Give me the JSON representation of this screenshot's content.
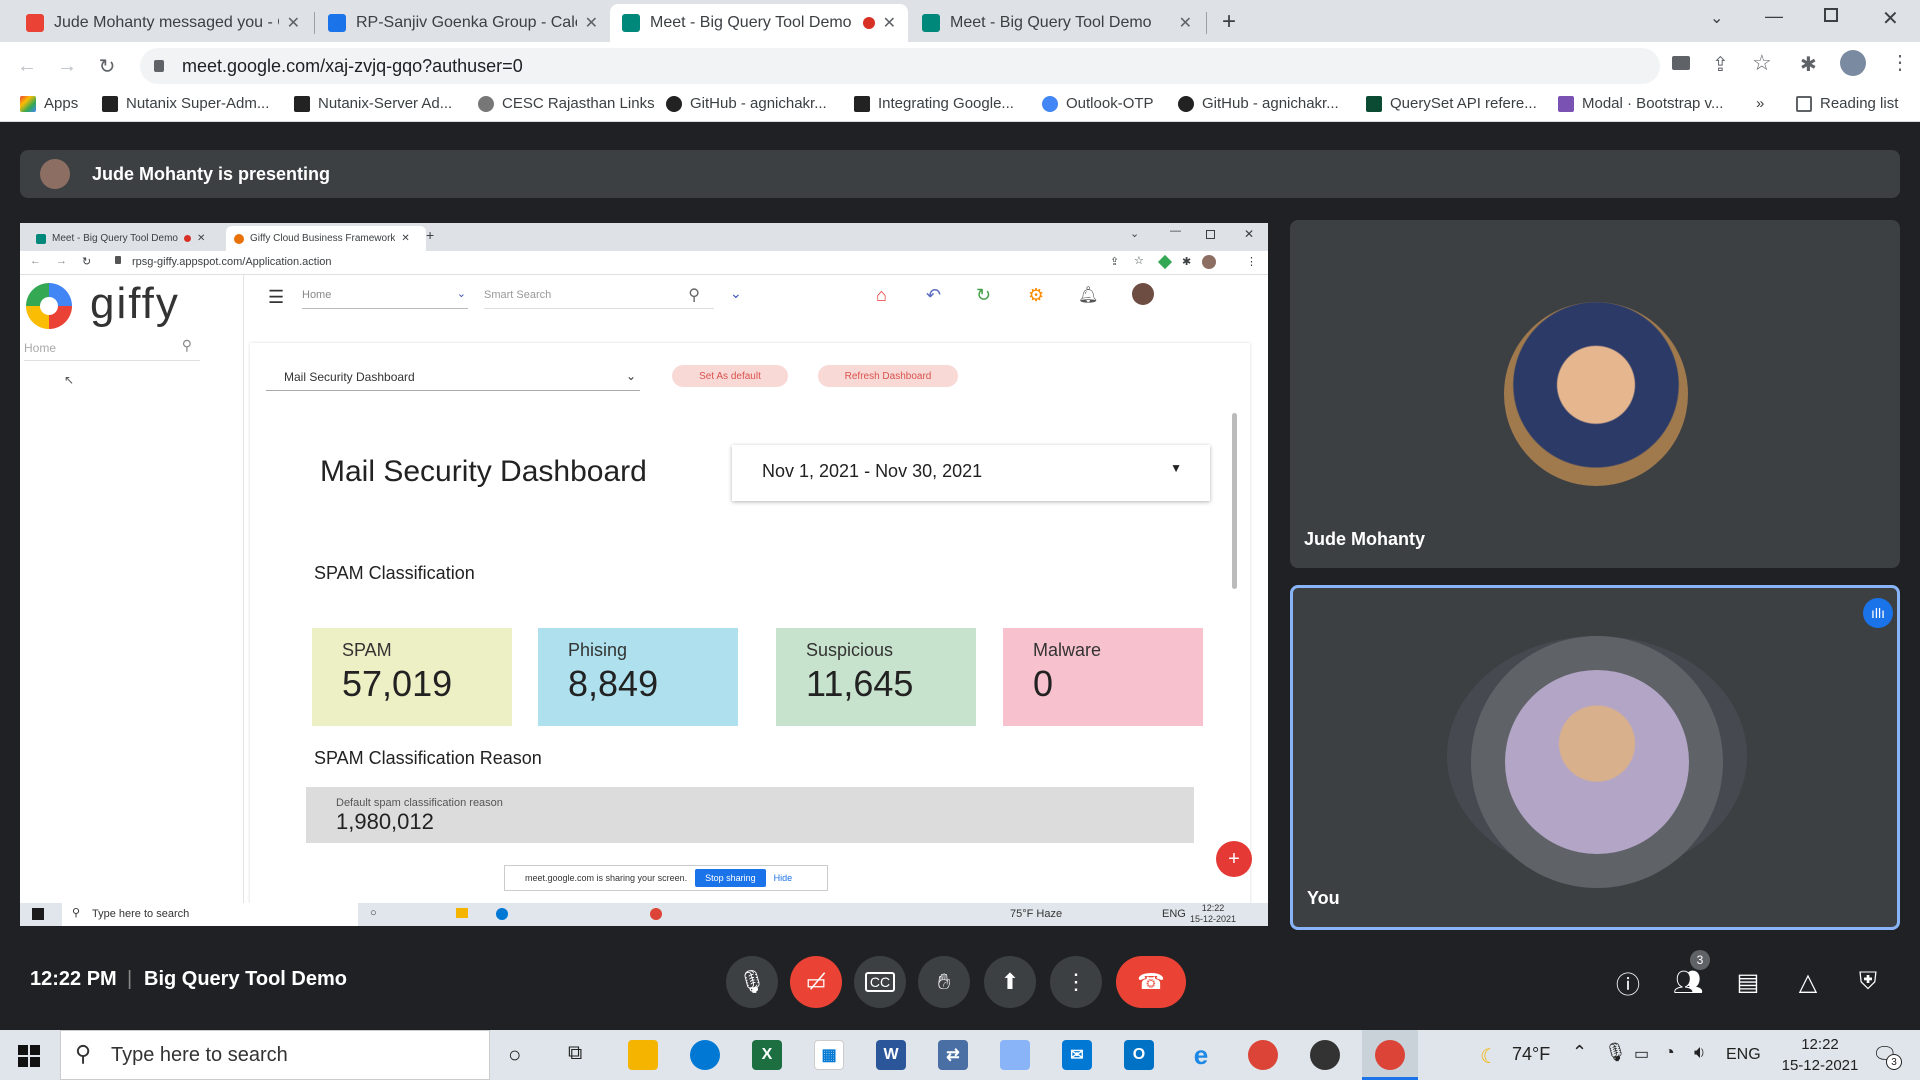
{
  "browser": {
    "tabs": [
      {
        "title": "Jude Mohanty messaged you - C",
        "color": "#ea4335"
      },
      {
        "title": "RP-Sanjiv Goenka Group - Calend",
        "color": "#1a73e8"
      },
      {
        "title": "Meet - Big Query Tool Demo",
        "color": "#00897b",
        "recording": true
      },
      {
        "title": "Meet - Big Query Tool Demo",
        "color": "#00897b"
      }
    ],
    "url": "meet.google.com/xaj-zvjq-gqo?authuser=0",
    "bookmarks": [
      "Apps",
      "Nutanix Super-Adm...",
      "Nutanix-Server Ad...",
      "CESC Rajasthan Links",
      "GitHub - agnichakr...",
      "Integrating Google...",
      "Outlook-OTP",
      "GitHub - agnichakr...",
      "QuerySet API refere...",
      "Modal · Bootstrap v..."
    ],
    "reading_list": "Reading list",
    "more": "»"
  },
  "meet": {
    "presenting": "Jude Mohanty is presenting",
    "time": "12:22 PM",
    "separator": "|",
    "meeting_title": "Big Query Tool Demo",
    "participants": [
      {
        "name": "Jude Mohanty"
      },
      {
        "name": "You"
      }
    ],
    "people_count": "3"
  },
  "shared": {
    "tabs": [
      "Meet - Big Query Tool Demo",
      "Giffy Cloud Business Framework"
    ],
    "url": "rpsg-giffy.appspot.com/Application.action",
    "logo": "giffy",
    "side_search_placeholder": "Home",
    "top": {
      "home": "Home",
      "smart_search": "Smart Search"
    },
    "dashboard_select": "Mail Security Dashboard",
    "set_default": "Set As default",
    "refresh": "Refresh Dashboard",
    "title": "Mail Security Dashboard",
    "date_range": "Nov 1, 2021 - Nov 30, 2021",
    "spam_class_heading": "SPAM Classification",
    "cards": [
      {
        "label": "SPAM",
        "value": "57,019",
        "color": "#edefc4"
      },
      {
        "label": "Phising",
        "value": "8,849",
        "color": "#aee0ed"
      },
      {
        "label": "Suspicious",
        "value": "11,645",
        "color": "#c8e3cd"
      },
      {
        "label": "Malware",
        "value": "0",
        "color": "#f7c1cd"
      }
    ],
    "reason_heading": "SPAM Classification Reason",
    "reason_label": "Default spam classification reason",
    "reason_value": "1,980,012",
    "sharing_msg": "meet.google.com is sharing your screen.",
    "stop_sharing": "Stop sharing",
    "hide": "Hide",
    "taskbar": {
      "search": "Type here to search",
      "weather": "75°F Haze",
      "lang": "ENG",
      "time": "12:22",
      "date": "15-12-2021"
    }
  },
  "taskbar": {
    "search": "Type here to search",
    "weather": "74°F",
    "lang": "ENG",
    "time": "12:22",
    "date": "15-12-2021",
    "notif_count": "3"
  }
}
